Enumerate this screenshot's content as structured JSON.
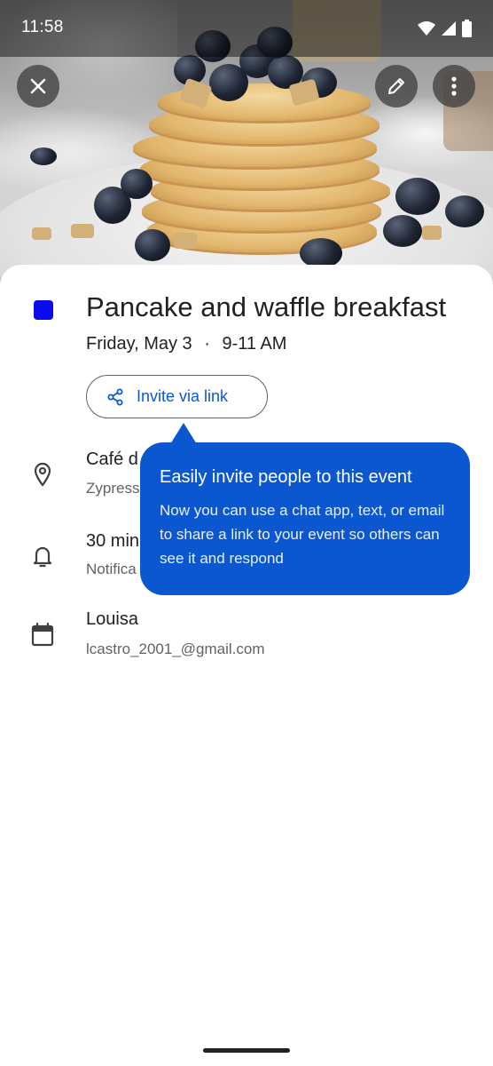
{
  "status_bar": {
    "time": "11:58"
  },
  "toolbar": {
    "close_icon": "close-icon",
    "edit_icon": "pencil-icon",
    "more_icon": "more-vert-icon"
  },
  "event": {
    "color": "#0b0bf0",
    "title": "Pancake and waffle breakfast",
    "date": "Friday, May 3",
    "separator": "·",
    "time": "9-11 AM",
    "invite_button_label": "Invite via link"
  },
  "details": {
    "location": {
      "primary": "Café d",
      "secondary": "Zypress"
    },
    "notification": {
      "primary": "30 min",
      "secondary": "Notifica"
    },
    "calendar": {
      "primary": "Louisa",
      "secondary": "lcastro_2001_@gmail.com"
    }
  },
  "tooltip": {
    "title": "Easily invite people to this event",
    "body": "Now you can use a chat app, text, or email to share a link to your event so others can see it and respond"
  },
  "colors": {
    "accent": "#0b57d0",
    "tooltip_bg": "#0b57d0",
    "text_primary": "#202124",
    "text_secondary": "#5f6368"
  }
}
